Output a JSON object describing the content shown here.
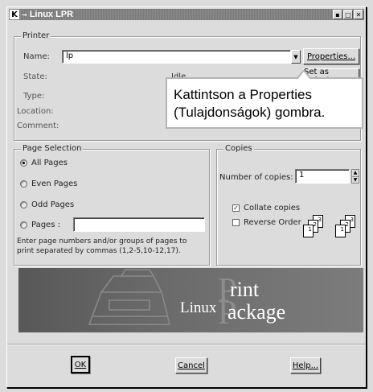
{
  "window": {
    "title": "Linux LPR",
    "app_icon": "K",
    "controls": [
      "minimize-icon",
      "maximize-icon",
      "close-icon"
    ]
  },
  "printer": {
    "legend": "Printer",
    "name_label": "Name:",
    "name_value": "lp",
    "properties_button": "Properties...",
    "state_label": "State:",
    "state_value": "Idle",
    "set_default_button": "Set as default",
    "type_label": "Type:",
    "location_label": "Location:",
    "comment_label": "Comment:"
  },
  "callout": {
    "line1": "Kattintson a Properties",
    "line2": "(Tulajdonságok) gombra."
  },
  "page_selection": {
    "legend": "Page Selection",
    "all_pages": "All Pages",
    "even_pages": "Even Pages",
    "odd_pages": "Odd Pages",
    "pages": "Pages :",
    "pages_value": "",
    "selected": "all_pages",
    "help_line1": "Enter page numbers and/or groups of pages to",
    "help_line2": "print separated by commas (1,2-5,10-12,17)."
  },
  "copies": {
    "legend": "Copies",
    "number_label": "Number of copies:",
    "number_value": "1",
    "collate_label": "Collate copies",
    "collate_checked": true,
    "reverse_label": "Reverse Order",
    "reverse_checked": false,
    "collate_icon_pages": [
      "3",
      "2",
      "1",
      "3",
      "2",
      "1"
    ]
  },
  "banner": {
    "linux": "Linux",
    "print": "rint",
    "package": "ackage",
    "p1": "P",
    "p2": "P"
  },
  "buttons": {
    "ok": "OK",
    "cancel": "Cancel",
    "help": "Help..."
  }
}
